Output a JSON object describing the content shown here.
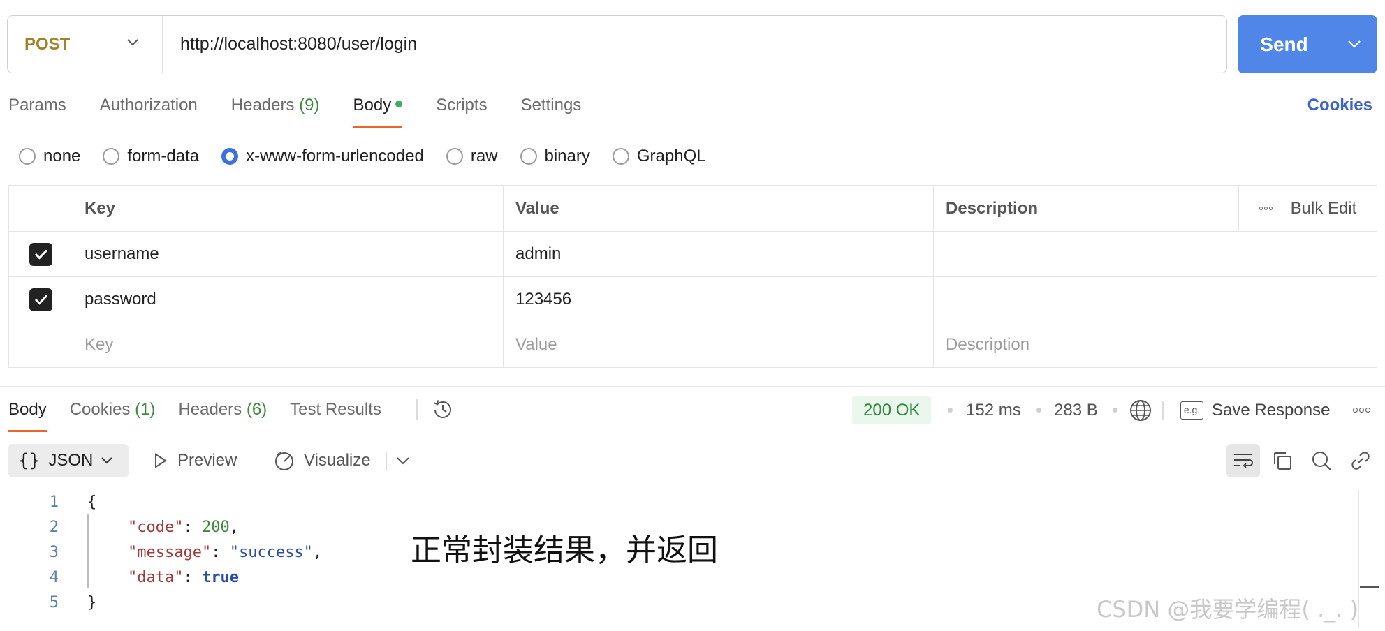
{
  "request": {
    "method": "POST",
    "url": "http://localhost:8080/user/login",
    "send_label": "Send"
  },
  "request_tabs": [
    {
      "label": "Params",
      "count": ""
    },
    {
      "label": "Authorization",
      "count": ""
    },
    {
      "label": "Headers",
      "count": "(9)"
    },
    {
      "label": "Body",
      "count": ""
    },
    {
      "label": "Scripts",
      "count": ""
    },
    {
      "label": "Settings",
      "count": ""
    }
  ],
  "cookies_label": "Cookies",
  "body_types": [
    "none",
    "form-data",
    "x-www-form-urlencoded",
    "raw",
    "binary",
    "GraphQL"
  ],
  "body_type_selected": "x-www-form-urlencoded",
  "params_table": {
    "headers": {
      "key": "Key",
      "value": "Value",
      "description": "Description",
      "bulk_edit": "Bulk Edit"
    },
    "rows": [
      {
        "checked": true,
        "key": "username",
        "value": "admin",
        "description": ""
      },
      {
        "checked": true,
        "key": "password",
        "value": "123456",
        "description": ""
      }
    ],
    "placeholders": {
      "key": "Key",
      "value": "Value",
      "description": "Description"
    }
  },
  "response_tabs": [
    {
      "label": "Body",
      "count": ""
    },
    {
      "label": "Cookies",
      "count": "(1)"
    },
    {
      "label": "Headers",
      "count": "(6)"
    },
    {
      "label": "Test Results",
      "count": ""
    }
  ],
  "response_meta": {
    "status": "200 OK",
    "time": "152 ms",
    "size": "283 B",
    "save_response": "Save Response",
    "save_response_icon_text": "e.g."
  },
  "viewer": {
    "format": "JSON",
    "preview": "Preview",
    "visualize": "Visualize"
  },
  "code_lines": [
    {
      "n": "1"
    },
    {
      "n": "2"
    },
    {
      "n": "3"
    },
    {
      "n": "4"
    },
    {
      "n": "5"
    }
  ],
  "code": {
    "open": "{",
    "close": "}",
    "k_code": "\"code\"",
    "v_code": "200",
    "k_message": "\"message\"",
    "v_message": "\"success\"",
    "k_data": "\"data\"",
    "v_data": "true",
    "colon": ": ",
    "comma": ","
  },
  "annotation": "正常封装结果，并返回",
  "watermark": "CSDN @我要学编程( ._. )",
  "colors": {
    "accent": "#4f86e8",
    "method": "#a0822a",
    "active_tab_underline": "#e8652b",
    "status_ok_bg": "#eaf7ec"
  }
}
